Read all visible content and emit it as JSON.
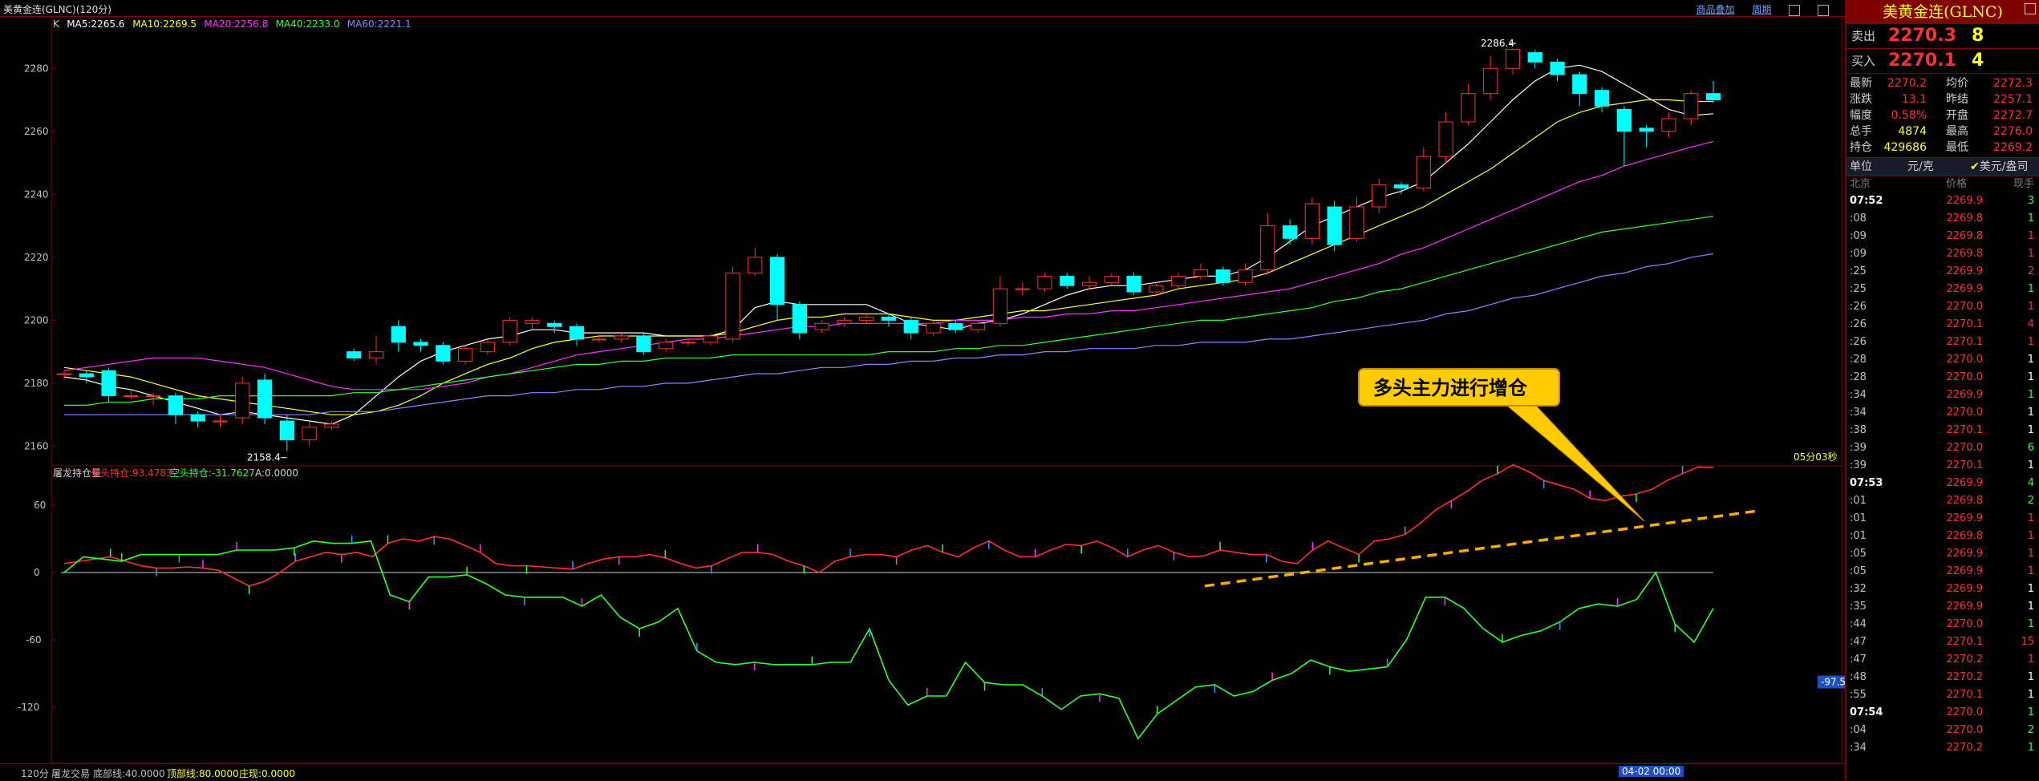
{
  "window": {
    "title": "美黄金连(GLNC)(120分)",
    "links": [
      "商品叠加",
      "周期"
    ]
  },
  "main_chart": {
    "legend": [
      {
        "label": "K",
        "color": "#d0d0d0"
      },
      {
        "label": "MA5:2265.6",
        "color": "#ffffff"
      },
      {
        "label": "MA10:2269.5",
        "color": "#ffff33"
      },
      {
        "label": "MA20:2256.8",
        "color": "#ff33ff"
      },
      {
        "label": "MA40:2233.0",
        "color": "#33ff33"
      },
      {
        "label": "MA60:2221.1",
        "color": "#8888ff"
      }
    ],
    "y_ticks": [
      "2280",
      "2260",
      "2240",
      "2220",
      "2200",
      "2180",
      "2160"
    ],
    "max_label": "2286.4",
    "min_label": "2158.4",
    "countdown": "05分03秒"
  },
  "chart_data": {
    "type": "candlestick",
    "ylim": [
      2154,
      2290
    ],
    "candles": [
      {
        "o": 2183,
        "c": 2183,
        "h": 2184,
        "l": 2181
      },
      {
        "o": 2183,
        "c": 2182,
        "h": 2184,
        "l": 2180
      },
      {
        "o": 2184,
        "c": 2176,
        "h": 2185,
        "l": 2174
      },
      {
        "o": 2176,
        "c": 2176,
        "h": 2178,
        "l": 2175
      },
      {
        "o": 2176,
        "c": 2176,
        "h": 2177,
        "l": 2173
      },
      {
        "o": 2176,
        "c": 2170,
        "h": 2177,
        "l": 2167
      },
      {
        "o": 2170,
        "c": 2168,
        "h": 2171,
        "l": 2166
      },
      {
        "o": 2168,
        "c": 2168,
        "h": 2170,
        "l": 2166
      },
      {
        "o": 2169,
        "c": 2180,
        "h": 2182,
        "l": 2167
      },
      {
        "o": 2181,
        "c": 2169,
        "h": 2183,
        "l": 2167
      },
      {
        "o": 2168,
        "c": 2162,
        "h": 2170,
        "l": 2158.4
      },
      {
        "o": 2162,
        "c": 2166,
        "h": 2168,
        "l": 2160
      },
      {
        "o": 2166,
        "c": 2167,
        "h": 2168,
        "l": 2165
      },
      {
        "o": 2190,
        "c": 2188,
        "h": 2191,
        "l": 2187
      },
      {
        "o": 2188,
        "c": 2190,
        "h": 2195,
        "l": 2186
      },
      {
        "o": 2198,
        "c": 2193,
        "h": 2200,
        "l": 2190
      },
      {
        "o": 2193,
        "c": 2192,
        "h": 2194,
        "l": 2190
      },
      {
        "o": 2192,
        "c": 2187,
        "h": 2193,
        "l": 2186
      },
      {
        "o": 2187,
        "c": 2191,
        "h": 2192,
        "l": 2186
      },
      {
        "o": 2190,
        "c": 2193,
        "h": 2194,
        "l": 2189
      },
      {
        "o": 2193,
        "c": 2200,
        "h": 2201,
        "l": 2192
      },
      {
        "o": 2199,
        "c": 2200,
        "h": 2201,
        "l": 2197
      },
      {
        "o": 2199,
        "c": 2198,
        "h": 2200,
        "l": 2196
      },
      {
        "o": 2198,
        "c": 2194,
        "h": 2199,
        "l": 2192
      },
      {
        "o": 2194,
        "c": 2194,
        "h": 2195,
        "l": 2193
      },
      {
        "o": 2194,
        "c": 2195,
        "h": 2196,
        "l": 2193
      },
      {
        "o": 2195,
        "c": 2190,
        "h": 2196,
        "l": 2189
      },
      {
        "o": 2191,
        "c": 2193,
        "h": 2194,
        "l": 2190
      },
      {
        "o": 2193,
        "c": 2193,
        "h": 2194,
        "l": 2192
      },
      {
        "o": 2193,
        "c": 2195,
        "h": 2196,
        "l": 2192
      },
      {
        "o": 2194,
        "c": 2215,
        "h": 2217,
        "l": 2193
      },
      {
        "o": 2215,
        "c": 2220,
        "h": 2223,
        "l": 2214
      },
      {
        "o": 2220,
        "c": 2205,
        "h": 2221,
        "l": 2200
      },
      {
        "o": 2205,
        "c": 2196,
        "h": 2206,
        "l": 2194
      },
      {
        "o": 2197,
        "c": 2199,
        "h": 2200,
        "l": 2196
      },
      {
        "o": 2199,
        "c": 2200,
        "h": 2201,
        "l": 2198
      },
      {
        "o": 2200,
        "c": 2201,
        "h": 2202,
        "l": 2199
      },
      {
        "o": 2201,
        "c": 2200,
        "h": 2202,
        "l": 2198
      },
      {
        "o": 2200,
        "c": 2196,
        "h": 2201,
        "l": 2194
      },
      {
        "o": 2196,
        "c": 2199,
        "h": 2200,
        "l": 2195
      },
      {
        "o": 2199,
        "c": 2197,
        "h": 2200,
        "l": 2196
      },
      {
        "o": 2197,
        "c": 2199,
        "h": 2200,
        "l": 2196
      },
      {
        "o": 2199,
        "c": 2210,
        "h": 2214,
        "l": 2198
      },
      {
        "o": 2210,
        "c": 2210,
        "h": 2212,
        "l": 2208
      },
      {
        "o": 2210,
        "c": 2214,
        "h": 2215,
        "l": 2209
      },
      {
        "o": 2214,
        "c": 2211,
        "h": 2215,
        "l": 2210
      },
      {
        "o": 2211,
        "c": 2212,
        "h": 2214,
        "l": 2210
      },
      {
        "o": 2212,
        "c": 2214,
        "h": 2215,
        "l": 2211
      },
      {
        "o": 2214,
        "c": 2209,
        "h": 2215,
        "l": 2208
      },
      {
        "o": 2209,
        "c": 2211,
        "h": 2212,
        "l": 2208
      },
      {
        "o": 2211,
        "c": 2214,
        "h": 2215,
        "l": 2210
      },
      {
        "o": 2214,
        "c": 2216,
        "h": 2218,
        "l": 2213
      },
      {
        "o": 2216,
        "c": 2212,
        "h": 2217,
        "l": 2211
      },
      {
        "o": 2212,
        "c": 2216,
        "h": 2218,
        "l": 2211
      },
      {
        "o": 2216,
        "c": 2230,
        "h": 2234,
        "l": 2215
      },
      {
        "o": 2230,
        "c": 2226,
        "h": 2232,
        "l": 2224
      },
      {
        "o": 2226,
        "c": 2237,
        "h": 2239,
        "l": 2224
      },
      {
        "o": 2236,
        "c": 2224,
        "h": 2238,
        "l": 2222
      },
      {
        "o": 2226,
        "c": 2236,
        "h": 2239,
        "l": 2225
      },
      {
        "o": 2236,
        "c": 2243,
        "h": 2245,
        "l": 2234
      },
      {
        "o": 2243,
        "c": 2242,
        "h": 2244,
        "l": 2240
      },
      {
        "o": 2242,
        "c": 2252,
        "h": 2255,
        "l": 2241
      },
      {
        "o": 2252,
        "c": 2263,
        "h": 2266,
        "l": 2250
      },
      {
        "o": 2263,
        "c": 2272,
        "h": 2275,
        "l": 2262
      },
      {
        "o": 2272,
        "c": 2280,
        "h": 2284,
        "l": 2270
      },
      {
        "o": 2280,
        "c": 2286,
        "h": 2286.4,
        "l": 2278
      },
      {
        "o": 2285,
        "c": 2282,
        "h": 2286,
        "l": 2280
      },
      {
        "o": 2282,
        "c": 2278,
        "h": 2283,
        "l": 2276
      },
      {
        "o": 2278,
        "c": 2272,
        "h": 2279,
        "l": 2268
      },
      {
        "o": 2273,
        "c": 2268,
        "h": 2274,
        "l": 2266
      },
      {
        "o": 2267,
        "c": 2260,
        "h": 2268,
        "l": 2249
      },
      {
        "o": 2261,
        "c": 2260,
        "h": 2262,
        "l": 2255
      },
      {
        "o": 2260,
        "c": 2264,
        "h": 2266,
        "l": 2258
      },
      {
        "o": 2264,
        "c": 2272,
        "h": 2273,
        "l": 2262
      },
      {
        "o": 2272,
        "c": 2270,
        "h": 2276,
        "l": 2269
      }
    ],
    "ma": {
      "MA5": [
        2182,
        2181,
        2179,
        2178,
        2176,
        2174,
        2172,
        2170,
        2171,
        2170,
        2169,
        2168,
        2167,
        2170,
        2176,
        2182,
        2187,
        2190,
        2192,
        2194,
        2195,
        2197,
        2197,
        2196,
        2196,
        2196,
        2196,
        2195,
        2195,
        2195,
        2197,
        2204,
        2206,
        2205,
        2205,
        2205,
        2205,
        2202,
        2199,
        2198,
        2197,
        2199,
        2200,
        2202,
        2205,
        2208,
        2210,
        2211,
        2211,
        2212,
        2213,
        2214,
        2214,
        2216,
        2220,
        2225,
        2230,
        2233,
        2236,
        2239,
        2241,
        2244,
        2250,
        2256,
        2263,
        2270,
        2276,
        2280,
        2281,
        2279,
        2275,
        2271,
        2267,
        2265,
        2265.6
      ],
      "MA10": [
        2185,
        2184,
        2183,
        2182,
        2180,
        2178,
        2176,
        2175,
        2174,
        2173,
        2172,
        2171,
        2170,
        2170,
        2171,
        2173,
        2176,
        2180,
        2183,
        2186,
        2188,
        2191,
        2193,
        2194,
        2195,
        2195,
        2195,
        2195,
        2195,
        2195,
        2196,
        2198,
        2200,
        2201,
        2201,
        2202,
        2202,
        2202,
        2201,
        2200,
        2200,
        2201,
        2202,
        2203,
        2203,
        2204,
        2205,
        2206,
        2207,
        2208,
        2210,
        2211,
        2212,
        2213,
        2215,
        2218,
        2221,
        2224,
        2227,
        2230,
        2233,
        2236,
        2240,
        2244,
        2248,
        2253,
        2258,
        2263,
        2266,
        2268,
        2269,
        2270,
        2270,
        2269.5,
        2269.5
      ],
      "MA20": [
        2184,
        2185,
        2186,
        2187,
        2188,
        2188,
        2188,
        2187,
        2186,
        2185,
        2183,
        2181,
        2179,
        2178,
        2178,
        2178,
        2178,
        2179,
        2180,
        2182,
        2183,
        2185,
        2187,
        2189,
        2190,
        2191,
        2192,
        2193,
        2194,
        2194,
        2195,
        2196,
        2197,
        2198,
        2198,
        2199,
        2199,
        2199,
        2199,
        2199,
        2200,
        2200,
        2200,
        2201,
        2201,
        2202,
        2202,
        2203,
        2203,
        2204,
        2205,
        2206,
        2207,
        2208,
        2209,
        2210,
        2212,
        2214,
        2216,
        2218,
        2221,
        2223,
        2226,
        2229,
        2232,
        2235,
        2238,
        2241,
        2244,
        2246,
        2249,
        2251,
        2253,
        2255,
        2256.8
      ],
      "MA40": [
        2173,
        2173,
        2174,
        2174,
        2175,
        2175,
        2175,
        2176,
        2176,
        2176,
        2176,
        2176,
        2176,
        2177,
        2177,
        2178,
        2179,
        2180,
        2181,
        2182,
        2183,
        2184,
        2185,
        2186,
        2186,
        2187,
        2187,
        2188,
        2188,
        2188,
        2189,
        2189,
        2189,
        2189,
        2189,
        2189,
        2189,
        2190,
        2190,
        2190,
        2191,
        2191,
        2192,
        2192,
        2193,
        2194,
        2195,
        2196,
        2197,
        2198,
        2199,
        2200,
        2200,
        2201,
        2202,
        2203,
        2204,
        2206,
        2207,
        2209,
        2210,
        2212,
        2214,
        2216,
        2218,
        2220,
        2222,
        2224,
        2226,
        2228,
        2229,
        2230,
        2231,
        2232,
        2233.0
      ],
      "MA60": [
        2170,
        2170,
        2170,
        2170,
        2170,
        2170,
        2170,
        2170,
        2170,
        2170,
        2170,
        2170,
        2171,
        2171,
        2171,
        2172,
        2173,
        2174,
        2175,
        2176,
        2176,
        2177,
        2177,
        2178,
        2178,
        2179,
        2179,
        2180,
        2180,
        2181,
        2182,
        2183,
        2183,
        2184,
        2185,
        2185,
        2186,
        2186,
        2187,
        2187,
        2188,
        2188,
        2189,
        2189,
        2190,
        2190,
        2191,
        2191,
        2191,
        2192,
        2192,
        2193,
        2193,
        2193,
        2194,
        2194,
        2195,
        2196,
        2197,
        2198,
        2199,
        2200,
        2202,
        2203,
        2205,
        2207,
        2208,
        2210,
        2212,
        2214,
        2215,
        2217,
        2218,
        2220,
        2221.1
      ]
    },
    "sub": {
      "y_ticks": [
        "60",
        "0",
        "-60",
        "-120"
      ],
      "ylim": [
        -165,
        60
      ],
      "long": [
        8,
        10,
        12,
        14,
        10,
        6,
        4,
        4,
        5,
        4,
        2,
        -5,
        -12,
        -8,
        0,
        10,
        14,
        18,
        16,
        18,
        14,
        26,
        30,
        28,
        32,
        30,
        24,
        18,
        8,
        6,
        6,
        5,
        4,
        3,
        8,
        12,
        14,
        14,
        16,
        13,
        8,
        4,
        6,
        12,
        18,
        18,
        16,
        10,
        6,
        0,
        10,
        14,
        16,
        16,
        14,
        20,
        24,
        18,
        14,
        22,
        28,
        20,
        14,
        14,
        20,
        25,
        24,
        28,
        22,
        14,
        20,
        24,
        18,
        14,
        15,
        20,
        18,
        16,
        16,
        10,
        8,
        20,
        28,
        22,
        16,
        28,
        30,
        34,
        44,
        56,
        64,
        72,
        82,
        88,
        96,
        90,
        82,
        78,
        74,
        66,
        64,
        68,
        70,
        74,
        82,
        88,
        94,
        93.5
      ],
      "short": [
        0,
        14,
        12,
        10,
        16,
        16,
        16,
        16,
        16,
        20,
        20,
        20,
        22,
        28,
        26,
        26,
        28,
        -20,
        -26,
        -4,
        -4,
        -2,
        -10,
        -20,
        -22,
        -22,
        -22,
        -30,
        -20,
        -40,
        -50,
        -44,
        -32,
        -70,
        -80,
        -82,
        -80,
        -82,
        -82,
        -82,
        -80,
        -80,
        -50,
        -96,
        -118,
        -110,
        -110,
        -80,
        -98,
        -100,
        -100,
        -110,
        -122,
        -110,
        -108,
        -112,
        -148,
        -126,
        -114,
        -102,
        -100,
        -110,
        -106,
        -96,
        -90,
        -78,
        -84,
        -88,
        -86,
        -84,
        -60,
        -22,
        -22,
        -32,
        -50,
        -62,
        -56,
        -52,
        -44,
        -32,
        -28,
        -30,
        -24,
        0,
        -46,
        -62,
        -31.8
      ]
    }
  },
  "sub_chart": {
    "legend": [
      {
        "label": "屠龙持仓量",
        "color": "#d0d0d0"
      },
      {
        "label": "多头持仓:93.4783",
        "color": "#ff3030"
      },
      {
        "label": "空头持仓:-31.7627",
        "color": "#33ff33"
      },
      {
        "label": "A:0.0000",
        "color": "#d0d0d0"
      }
    ],
    "right_value": "-97.5",
    "annotation": "多头主力进行增仓"
  },
  "bottom_bar": {
    "period": "120分",
    "indicator_name": "屠龙交易",
    "items": [
      "底部线:40.0000",
      "顶部线:80.0000",
      "庄现:0.0000"
    ],
    "cursor_time": "04-02 00:00"
  },
  "quote_panel": {
    "title": "美黄金连(GLNC)",
    "sell_label": "卖出",
    "sell_price": "2270.3",
    "sell_vol": "8",
    "buy_label": "买入",
    "buy_price": "2270.1",
    "buy_vol": "4",
    "stats": [
      [
        "最新",
        "2270.2",
        "均价",
        "2272.3"
      ],
      [
        "涨跌",
        "13.1",
        "昨结",
        "2257.1"
      ],
      [
        "幅度",
        "0.58%",
        "开盘",
        "2272.7"
      ],
      [
        "总手",
        "4874",
        "最高",
        "2276.0"
      ],
      [
        "持仓",
        "429686",
        "最低",
        "2269.2"
      ]
    ],
    "unit_label": "单位",
    "unit_value": "元/克",
    "unit_alt": "美元/盎司",
    "tick_headers": [
      "北京",
      "价格",
      "现手"
    ],
    "ticks": [
      [
        "07:52",
        "2269.9",
        "3",
        "g"
      ],
      [
        ":08",
        "2269.8",
        "1",
        "g"
      ],
      [
        ":09",
        "2269.8",
        "1",
        "r"
      ],
      [
        ":09",
        "2269.8",
        "1",
        "r"
      ],
      [
        ":25",
        "2269.9",
        "2",
        "r"
      ],
      [
        ":25",
        "2269.9",
        "1",
        "g"
      ],
      [
        ":26",
        "2270.0",
        "1",
        "r"
      ],
      [
        ":26",
        "2270.1",
        "4",
        "r"
      ],
      [
        ":26",
        "2270.1",
        "1",
        "r"
      ],
      [
        ":28",
        "2270.0",
        "1",
        "w"
      ],
      [
        ":28",
        "2270.0",
        "1",
        "w"
      ],
      [
        ":34",
        "2269.9",
        "1",
        "g"
      ],
      [
        ":34",
        "2270.0",
        "1",
        "w"
      ],
      [
        ":38",
        "2270.1",
        "1",
        "w"
      ],
      [
        ":39",
        "2270.0",
        "6",
        "g"
      ],
      [
        ":39",
        "2270.1",
        "1",
        "w"
      ],
      [
        "07:53",
        "2269.9",
        "4",
        "g"
      ],
      [
        ":01",
        "2269.8",
        "2",
        "g"
      ],
      [
        ":01",
        "2269.9",
        "1",
        "r"
      ],
      [
        ":01",
        "2269.8",
        "1",
        "r"
      ],
      [
        ":05",
        "2269.9",
        "1",
        "r"
      ],
      [
        ":05",
        "2269.9",
        "1",
        "r"
      ],
      [
        ":32",
        "2269.9",
        "1",
        "w"
      ],
      [
        ":35",
        "2269.9",
        "1",
        "w"
      ],
      [
        ":44",
        "2270.0",
        "1",
        "g"
      ],
      [
        ":47",
        "2270.1",
        "15",
        "r"
      ],
      [
        ":47",
        "2270.2",
        "1",
        "r"
      ],
      [
        ":48",
        "2270.2",
        "1",
        "w"
      ],
      [
        ":55",
        "2270.1",
        "1",
        "w"
      ],
      [
        "07:54",
        "2270.0",
        "1",
        "g"
      ],
      [
        ":04",
        "2270.0",
        "2",
        "g"
      ],
      [
        ":34",
        "2270.2",
        "1",
        "g"
      ]
    ]
  }
}
